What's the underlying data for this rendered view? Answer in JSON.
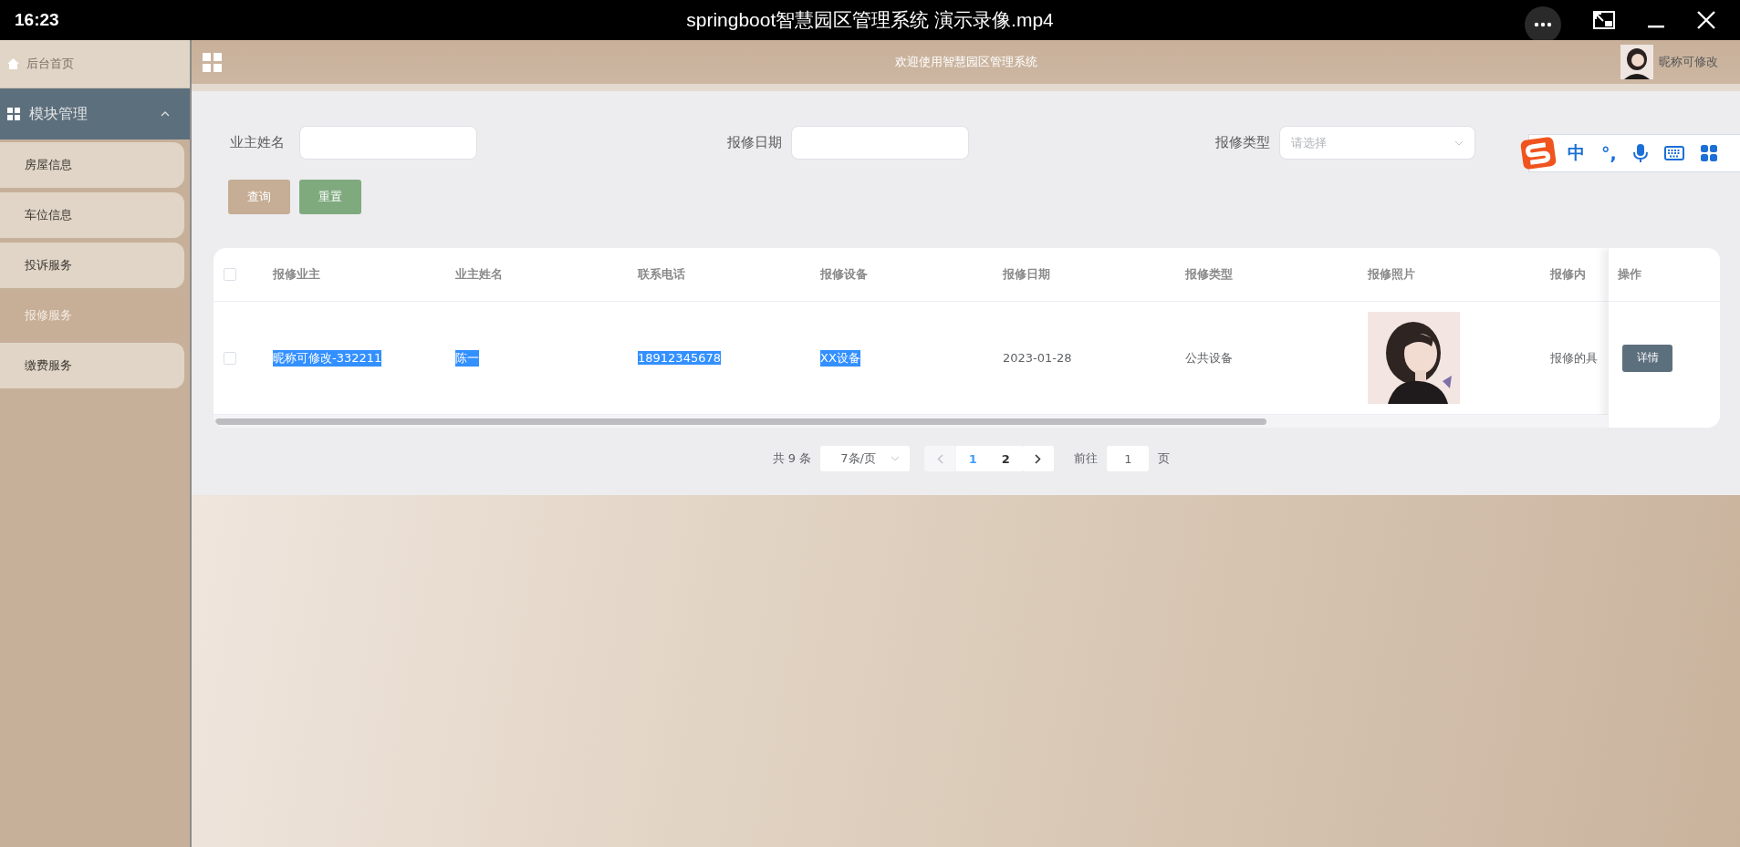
{
  "player": {
    "time": "16:23",
    "title": "springboot智慧园区管理系统 演示录像.mp4"
  },
  "header": {
    "title": "欢迎使用智慧园区管理系统",
    "user": "昵称可修改"
  },
  "sidebar": {
    "home": "后台首页",
    "group": {
      "label": "模块管理",
      "expanded": true
    },
    "items": [
      {
        "label": "房屋信息",
        "selected": false
      },
      {
        "label": "车位信息",
        "selected": false
      },
      {
        "label": "投诉服务",
        "selected": false
      },
      {
        "label": "报修服务",
        "selected": true
      },
      {
        "label": "缴费服务",
        "selected": false
      }
    ]
  },
  "search": {
    "fields": [
      {
        "label": "业主姓名",
        "kind": "input"
      },
      {
        "label": "报修日期",
        "kind": "input"
      },
      {
        "label": "报修类型",
        "kind": "select",
        "placeholder": "请选择"
      }
    ],
    "buttons": [
      {
        "label": "查询",
        "kind": "primary"
      },
      {
        "label": "重置",
        "kind": "reset"
      }
    ]
  },
  "table": {
    "all_checked": false,
    "columns": [
      "报修业主",
      "业主姓名",
      "联系电话",
      "报修设备",
      "报修日期",
      "报修类型",
      "报修照片",
      "报修内",
      "操作"
    ],
    "rows": [
      {
        "checked": false,
        "cells": [
          {
            "text": "昵称可修改-332211",
            "highlighted": true
          },
          {
            "text": "陈一",
            "highlighted": true
          },
          {
            "text": "18912345678",
            "highlighted": true
          },
          {
            "text": "XX设备",
            "highlighted": true
          },
          {
            "text": "2023-01-28",
            "highlighted": false
          },
          {
            "text": "公共设备",
            "highlighted": false
          },
          {
            "kind": "picture"
          },
          {
            "text": "报修的具",
            "highlighted": false
          }
        ],
        "action": "详情"
      }
    ]
  },
  "pagination": {
    "total": "共 9 条",
    "page_size": "7条/页",
    "prev_disabled": true,
    "pages": [
      {
        "label": "1",
        "selected": true
      },
      {
        "label": "2",
        "selected": false
      }
    ],
    "goto_label": "前往",
    "goto_value": "1",
    "goto_suffix": "页"
  },
  "ime": {
    "mode": "中",
    "punct": "°,"
  }
}
